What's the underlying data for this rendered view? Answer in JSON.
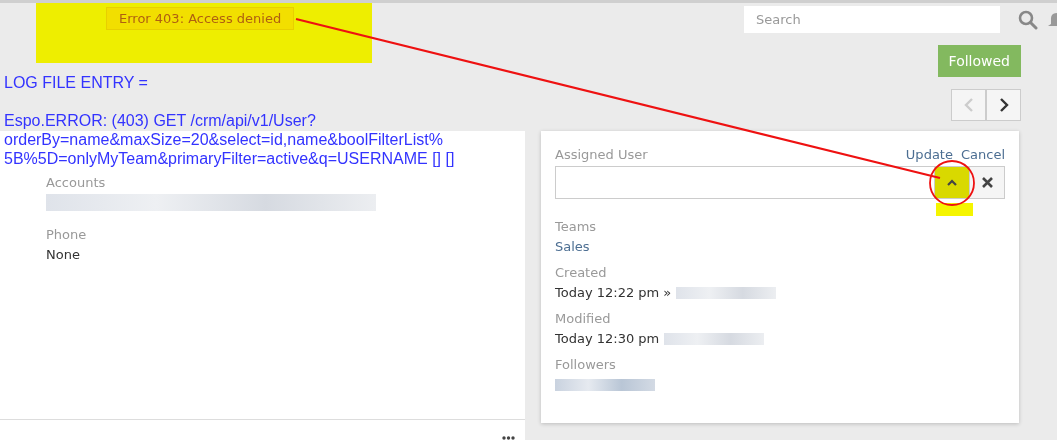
{
  "notification": {
    "text": "Error 403: Access denied"
  },
  "search": {
    "placeholder": "Search"
  },
  "log_note": {
    "lines": [
      "LOG FILE ENTRY =",
      "Espo.ERROR: (403) GET /crm/api/v1/User?",
      "orderBy=name&maxSize=20&select=id,name&boolFilterList%",
      "5B%5D=onlyMyTeam&primaryFilter=active&q=USERNAME [] []"
    ]
  },
  "follow_button": {
    "label": "Followed"
  },
  "left_fields": [
    {
      "label": "Accounts",
      "redacted": true
    },
    {
      "label": "Phone",
      "value": "None",
      "redacted": false
    }
  ],
  "assigned_user": {
    "label": "Assigned User",
    "actions": [
      "Update",
      "Cancel"
    ]
  },
  "side_fields": [
    {
      "label": "Teams",
      "value": "Sales",
      "kind": "link",
      "redacted": false
    },
    {
      "label": "Created",
      "value": "Today 12:22 pm »",
      "kind": "text",
      "redacted": true
    },
    {
      "label": "Modified",
      "value": "Today 12:30 pm",
      "kind": "text",
      "redacted": true
    },
    {
      "label": "Followers",
      "kind": "link",
      "redacted": true
    }
  ]
}
